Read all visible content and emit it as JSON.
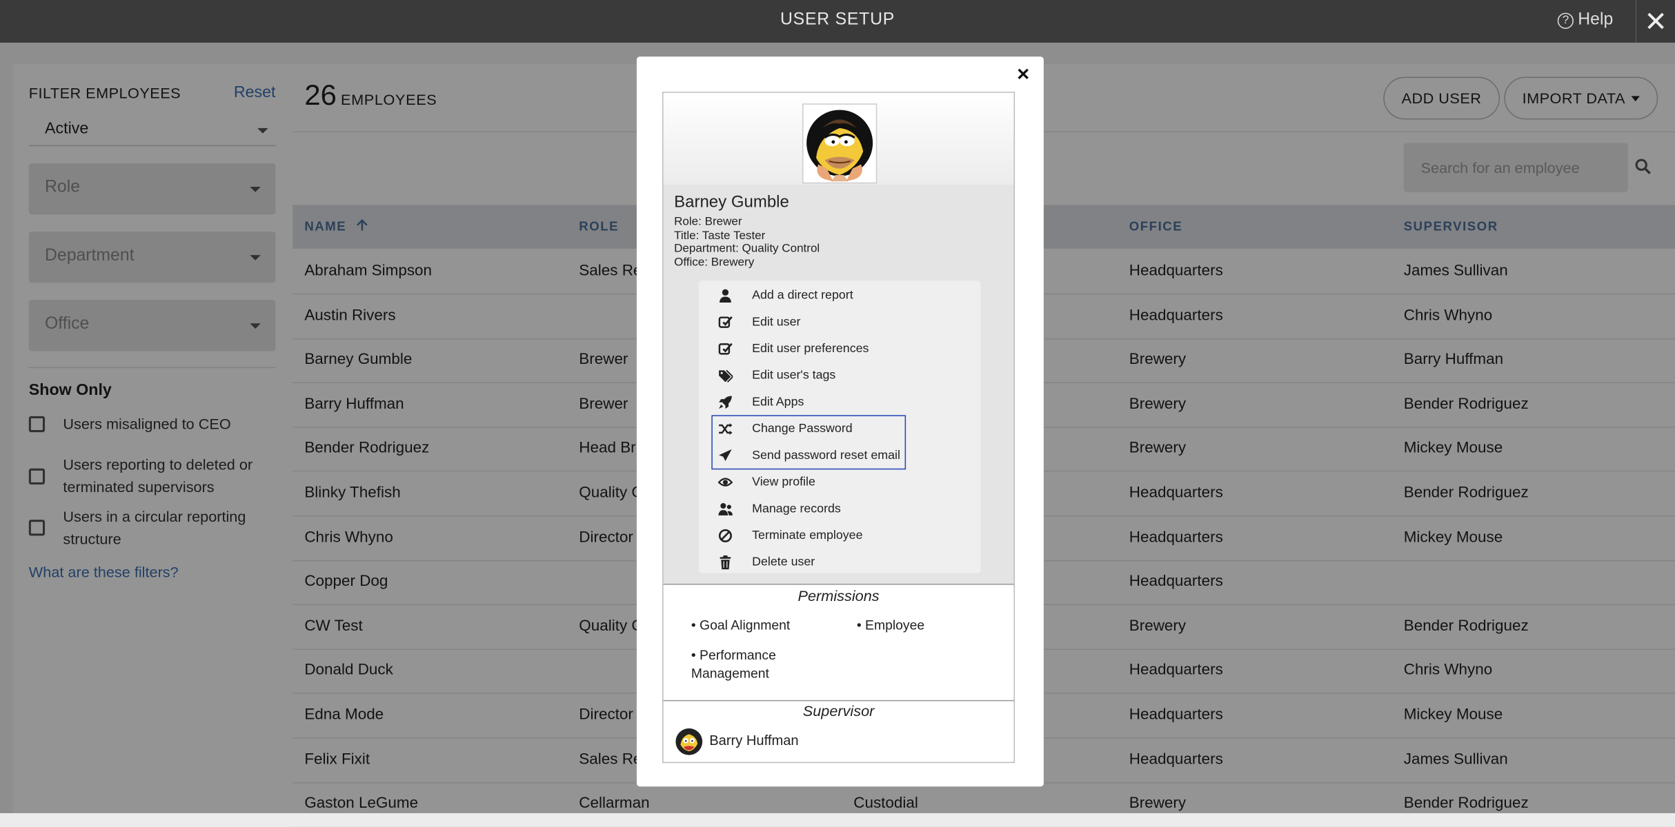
{
  "topbar": {
    "title": "USER SETUP",
    "help": "Help"
  },
  "sidebar": {
    "heading": "FILTER EMPLOYEES",
    "reset": "Reset",
    "status_value": "Active",
    "role_placeholder": "Role",
    "department_placeholder": "Department",
    "office_placeholder": "Office",
    "show_only": "Show Only",
    "checks": [
      "Users misaligned to CEO",
      "Users reporting to deleted or terminated supervisors",
      "Users in a circular reporting structure"
    ],
    "help_link": "What are these filters?"
  },
  "main": {
    "count": "26",
    "count_label": "EMPLOYEES",
    "add_user": "ADD USER",
    "import_data": "IMPORT DATA",
    "search_placeholder": "Search for an employee",
    "columns": [
      "NAME",
      "ROLE",
      "OFFICE",
      "SUPERVISOR"
    ],
    "rows": [
      {
        "name": "Abraham Simpson",
        "role": "Sales Re",
        "dept": "",
        "office": "Headquarters",
        "supervisor": "James Sullivan"
      },
      {
        "name": "Austin Rivers",
        "role": "",
        "dept": "",
        "office": "Headquarters",
        "supervisor": "Chris Whyno"
      },
      {
        "name": "Barney Gumble",
        "role": "Brewer",
        "dept": "",
        "office": "Brewery",
        "supervisor": "Barry Huffman"
      },
      {
        "name": "Barry Huffman",
        "role": "Brewer",
        "dept": "",
        "office": "Brewery",
        "supervisor": "Bender Rodriguez"
      },
      {
        "name": "Bender Rodriguez",
        "role": "Head Br",
        "dept": "",
        "office": "Brewery",
        "supervisor": "Mickey Mouse"
      },
      {
        "name": "Blinky Thefish",
        "role": "Quality C",
        "dept": "",
        "office": "Headquarters",
        "supervisor": "Bender Rodriguez"
      },
      {
        "name": "Chris Whyno",
        "role": "Director",
        "dept": "",
        "office": "Headquarters",
        "supervisor": "Mickey Mouse"
      },
      {
        "name": "Copper Dog",
        "role": "",
        "dept": "",
        "office": "Headquarters",
        "supervisor": ""
      },
      {
        "name": "CW Test",
        "role": "Quality C",
        "dept": "",
        "office": "Brewery",
        "supervisor": "Bender Rodriguez"
      },
      {
        "name": "Donald Duck",
        "role": "",
        "dept": "",
        "office": "Headquarters",
        "supervisor": "Chris Whyno"
      },
      {
        "name": "Edna Mode",
        "role": "Director",
        "dept": "",
        "office": "Headquarters",
        "supervisor": "Mickey Mouse"
      },
      {
        "name": "Felix Fixit",
        "role": "Sales Re",
        "dept": "",
        "office": "Headquarters",
        "supervisor": "James Sullivan"
      },
      {
        "name": "Gaston LeGume",
        "role": "Cellarman",
        "dept": "Custodial",
        "office": "Brewery",
        "supervisor": "Bender Rodriguez"
      }
    ]
  },
  "modal": {
    "close": "×",
    "name": "Barney Gumble",
    "role": "Role: Brewer",
    "title": "Title: Taste Tester",
    "department": "Department: Quality Control",
    "office": "Office: Brewery",
    "menu": [
      {
        "label": "Add a direct report",
        "icon": "user-icon"
      },
      {
        "label": "Edit user",
        "icon": "edit-icon"
      },
      {
        "label": "Edit user preferences",
        "icon": "edit-icon"
      },
      {
        "label": "Edit user's tags",
        "icon": "tags-icon"
      },
      {
        "label": "Edit Apps",
        "icon": "rocket-icon"
      },
      {
        "label": "Change Password",
        "icon": "shuffle-icon"
      },
      {
        "label": "Send password reset email",
        "icon": "send-icon"
      },
      {
        "label": "View profile",
        "icon": "eye-icon"
      },
      {
        "label": "Manage records",
        "icon": "users-icon"
      },
      {
        "label": "Terminate employee",
        "icon": "ban-icon"
      },
      {
        "label": "Delete user",
        "icon": "trash-icon"
      }
    ],
    "permissions_title": "Permissions",
    "permissions": [
      "• Goal Alignment",
      "• Employee",
      "• Performance Management"
    ],
    "supervisor_title": "Supervisor",
    "supervisor_name": "Barry Huffman"
  },
  "colors": {
    "accent": "#3d6fb4",
    "highlight": "#2447b8",
    "topbar": "#3a3a3a"
  }
}
